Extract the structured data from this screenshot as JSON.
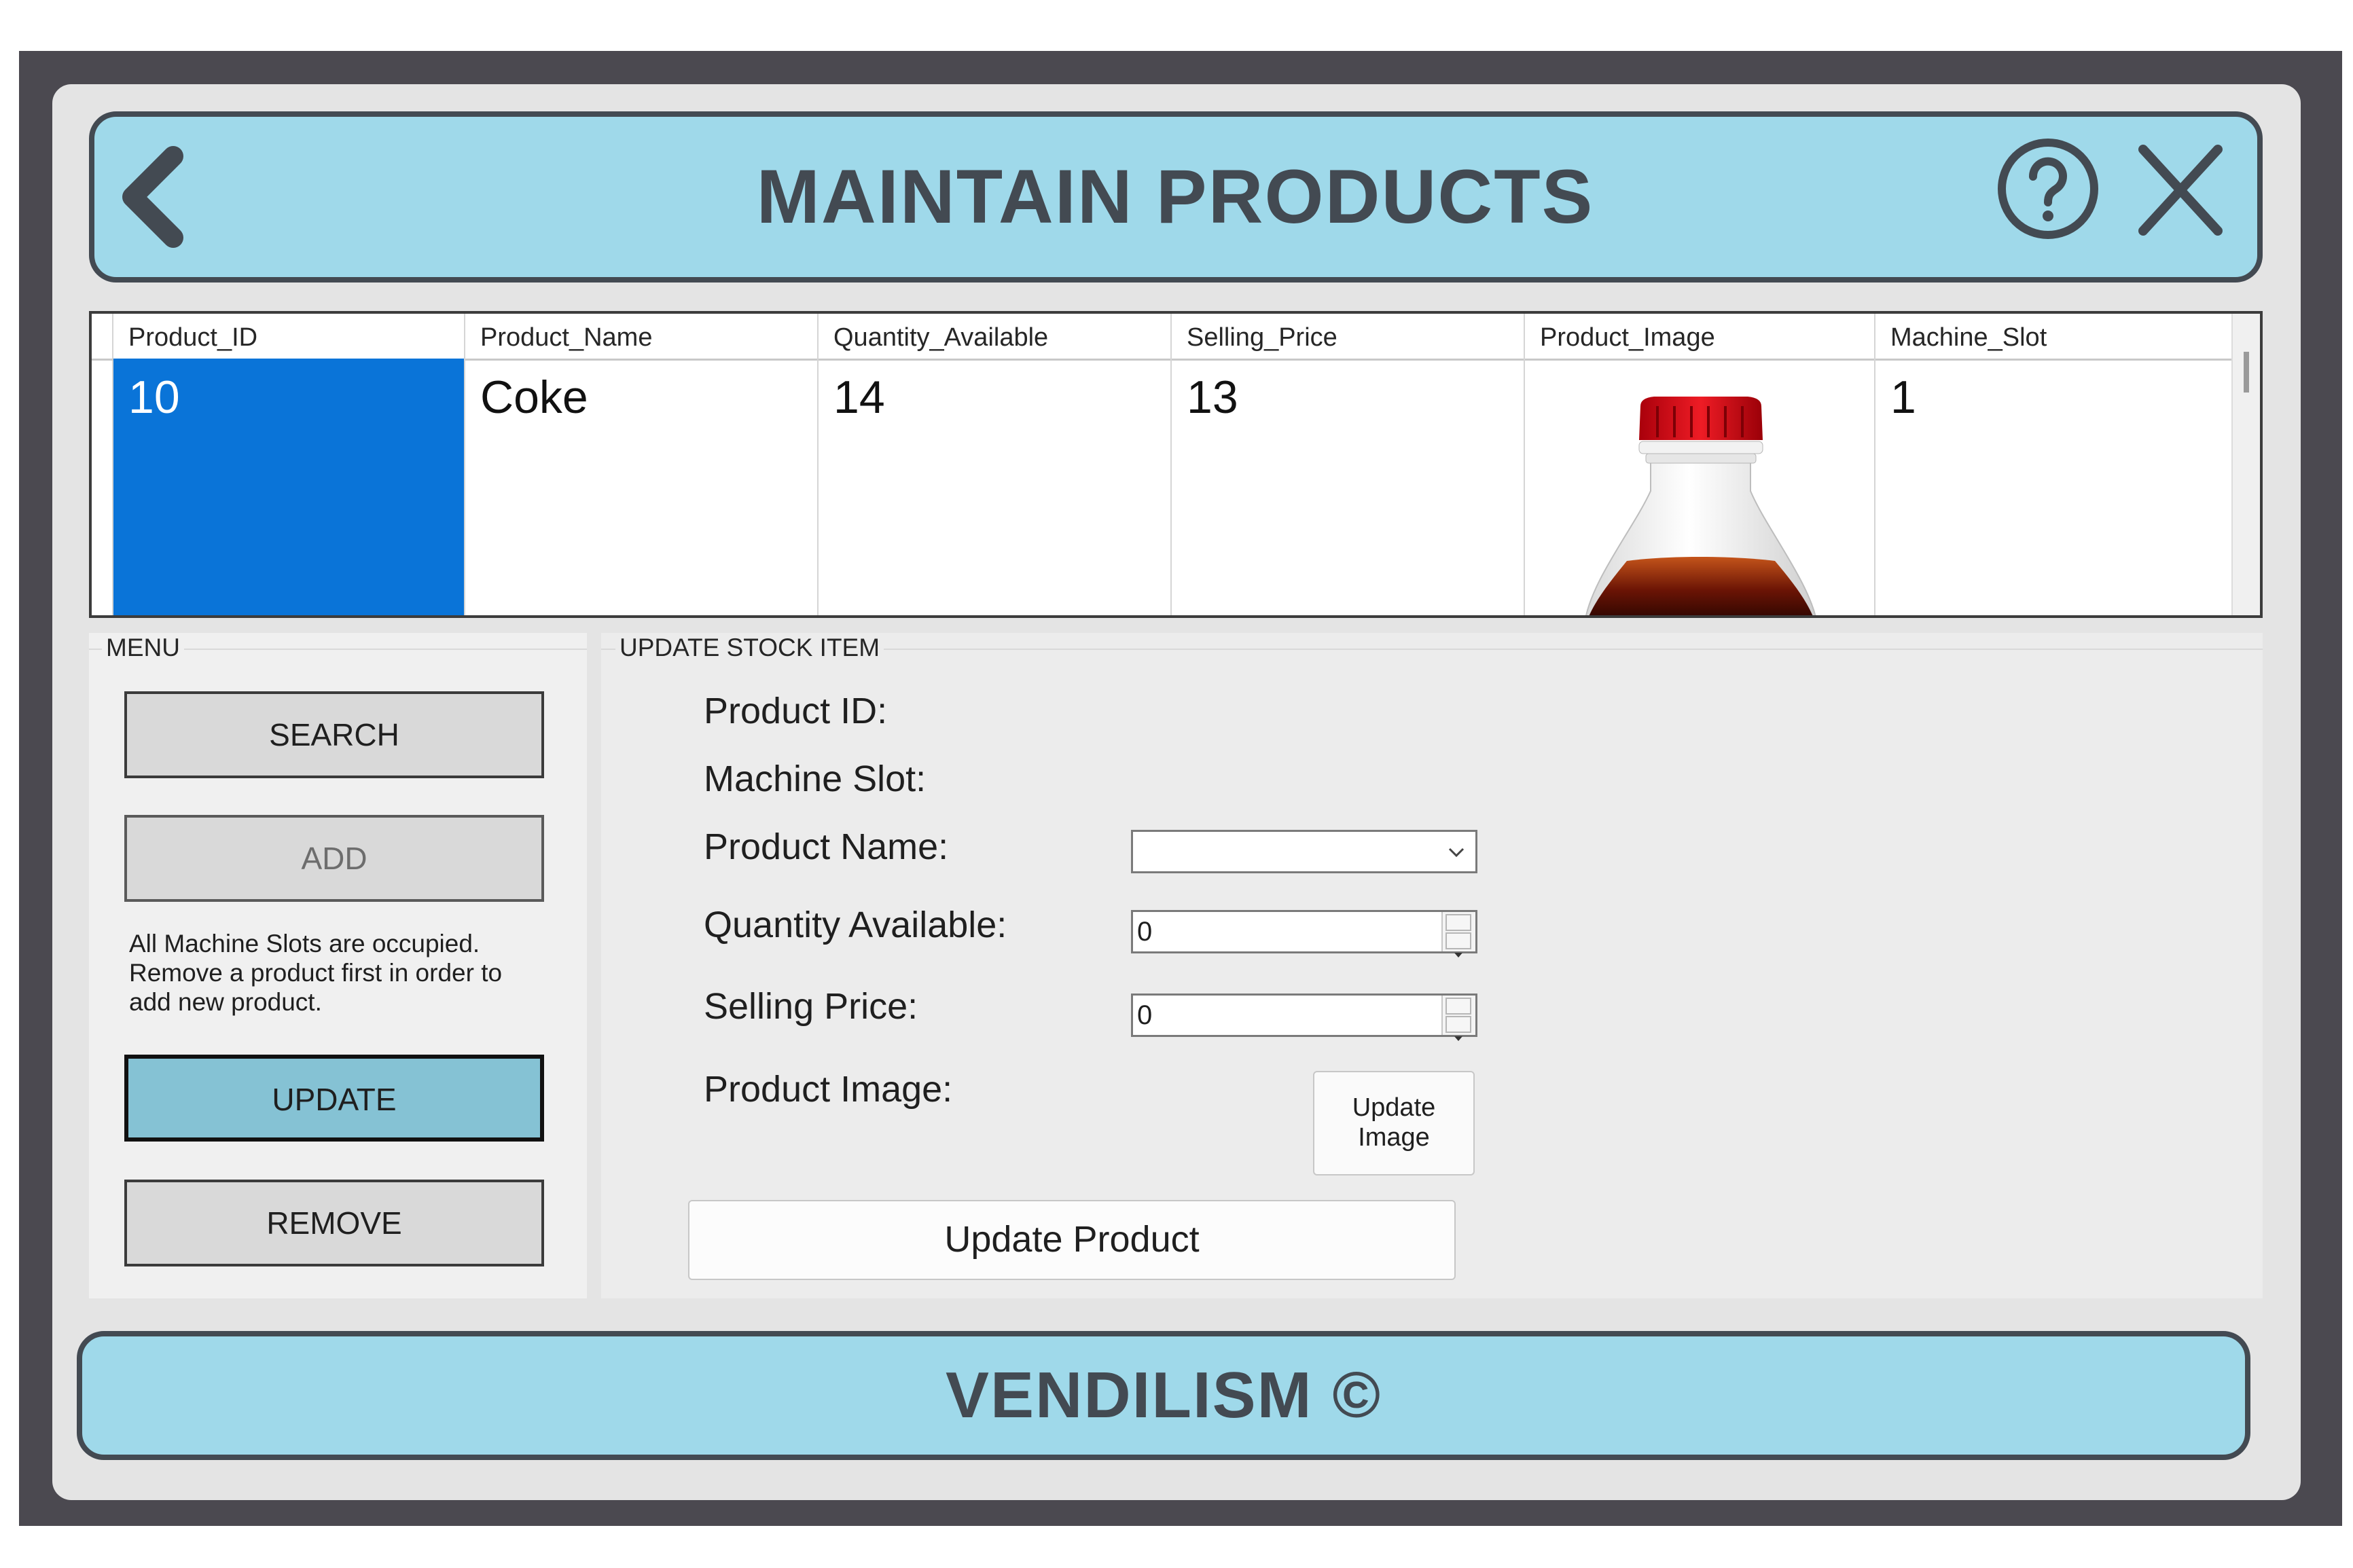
{
  "header": {
    "title": "MAINTAIN PRODUCTS",
    "back_icon": "chevron-left-icon",
    "help_icon": "question-circle-icon",
    "close_icon": "close-x-icon"
  },
  "grid": {
    "columns": [
      "Product_ID",
      "Product_Name",
      "Quantity_Available",
      "Selling_Price",
      "Product_Image",
      "Machine_Slot"
    ],
    "rows": [
      {
        "product_id": "10",
        "product_name": "Coke",
        "quantity_available": "14",
        "selling_price": "13",
        "product_image": "coke-bottle-image",
        "machine_slot": "1"
      }
    ]
  },
  "menu": {
    "title": "MENU",
    "search_label": "SEARCH",
    "add_label": "ADD",
    "note": "All Machine Slots are occupied. Remove a product first in order to add new product.",
    "update_label": "UPDATE",
    "remove_label": "REMOVE"
  },
  "update_form": {
    "title": "UPDATE STOCK ITEM",
    "product_id_label": "Product ID:",
    "machine_slot_label": "Machine Slot:",
    "product_name_label": "Product Name:",
    "product_name_value": "",
    "quantity_label": "Quantity Available:",
    "quantity_value": "0",
    "price_label": "Selling Price:",
    "price_value": "0",
    "image_label": "Product Image:",
    "update_image_label": "Update Image",
    "update_product_label": "Update Product"
  },
  "footer": {
    "text": "VENDILISM ©"
  },
  "colors": {
    "frame": "#4b4950",
    "accent_bar": "#9fd9ea",
    "accent_text": "#434a52",
    "selection": "#0a74d8",
    "active_button": "#85c2d4"
  }
}
